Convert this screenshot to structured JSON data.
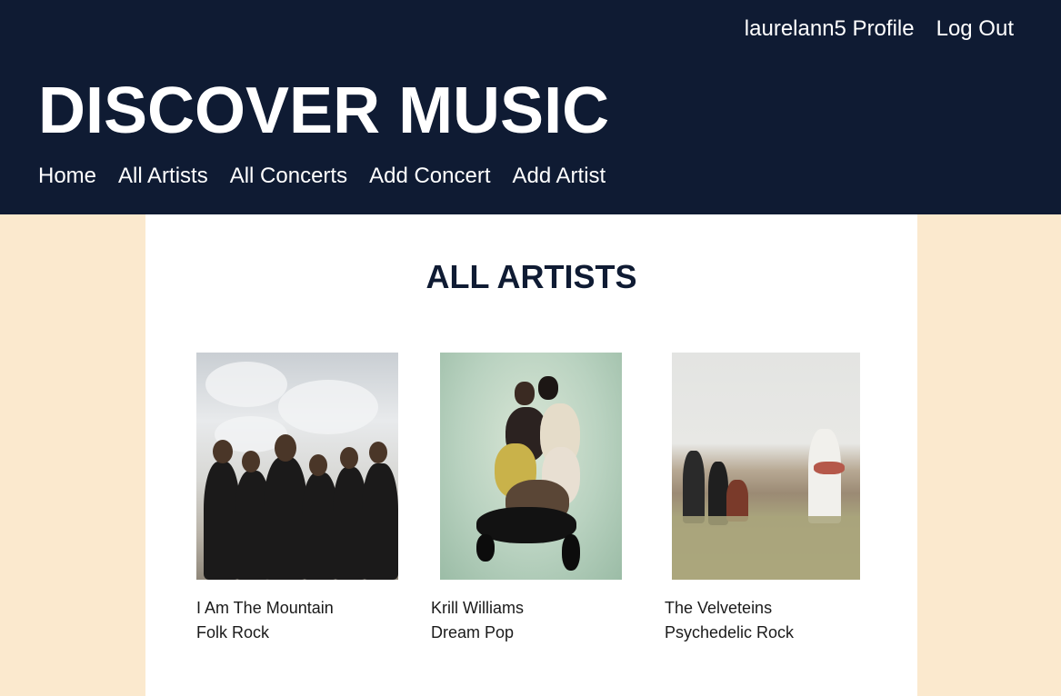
{
  "header": {
    "profile_link": "laurelann5 Profile",
    "logout_link": "Log Out",
    "site_title": "DISCOVER MUSIC",
    "nav": [
      "Home",
      "All Artists",
      "All Concerts",
      "Add Concert",
      "Add Artist"
    ]
  },
  "main": {
    "heading": "ALL ARTISTS",
    "artists": [
      {
        "name": "I Am The Mountain",
        "genre": "Folk Rock"
      },
      {
        "name": "Krill Williams",
        "genre": "Dream Pop"
      },
      {
        "name": "The Velveteins",
        "genre": "Psychedelic Rock"
      }
    ]
  },
  "colors": {
    "header_bg": "#0f1b33",
    "page_bg": "#fbe9ce",
    "content_bg": "#ffffff",
    "heading_text": "#0f1b33"
  }
}
